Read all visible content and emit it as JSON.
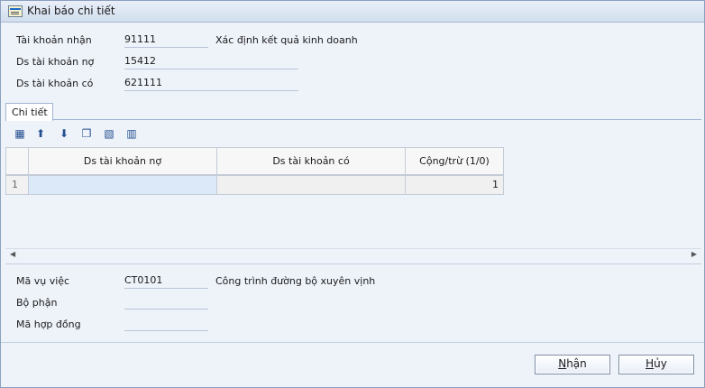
{
  "window": {
    "title": "Khai báo chi tiết"
  },
  "fields": {
    "account_receive": {
      "label": "Tài khoản nhận",
      "value": "91111",
      "desc": "Xác định kết quả kinh doanh"
    },
    "debit_list": {
      "label": "Ds tài khoản nợ",
      "value": "15412"
    },
    "credit_list": {
      "label": "Ds tài khoản có",
      "value": "621111"
    }
  },
  "tab": {
    "label": "Chi tiết"
  },
  "toolbar": {
    "icons": [
      "insert-row-icon",
      "move-up-icon",
      "move-down-icon",
      "copy-row-icon",
      "delete-row-icon",
      "insert-column-icon"
    ]
  },
  "grid": {
    "columns": [
      "Ds tài khoản nợ",
      "Ds tài khoản có",
      "Cộng/trừ (1/0)"
    ],
    "rows": [
      {
        "num": "1",
        "debit": "",
        "credit": "",
        "sign": "1"
      }
    ]
  },
  "bottom_fields": {
    "job": {
      "label": "Mã vụ việc",
      "value": "CT0101",
      "desc": "Công trình đường bộ xuyên vịnh"
    },
    "department": {
      "label": "Bộ phận",
      "value": ""
    },
    "contract": {
      "label": "Mã hợp đồng",
      "value": ""
    }
  },
  "buttons": {
    "ok": "Nhận",
    "cancel": "Hủy"
  }
}
